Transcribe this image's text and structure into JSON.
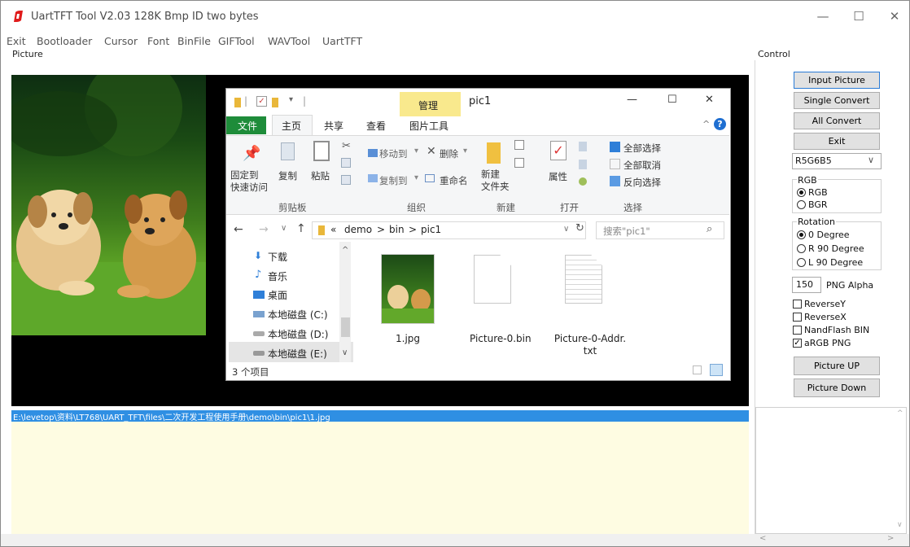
{
  "window": {
    "title": "UartTFT Tool V2.03 128K Bmp ID two bytes",
    "minimize_glyph": "—",
    "maximize_glyph": "☐",
    "close_glyph": "✕"
  },
  "menu": [
    "Exit",
    "Bootloader",
    "Cursor",
    "Font",
    "BinFile",
    "GIFTool",
    "WAVTool",
    "UartTFT"
  ],
  "sections": {
    "picture": "Picture",
    "control": "Control"
  },
  "explorer": {
    "context_tab": "管理",
    "folder_title": "pic1",
    "tabs": [
      "文件",
      "主页",
      "共享",
      "查看",
      "图片工具"
    ],
    "min_glyph": "—",
    "max_glyph": "☐",
    "close_glyph": "✕",
    "ribbon": {
      "pin": "固定到\n快速访问",
      "copy": "复制",
      "paste": "粘贴",
      "move_to": "移动到",
      "delete": "删除",
      "copy_to": "复制到",
      "rename": "重命名",
      "new_folder": "新建\n文件夹",
      "properties": "属性",
      "select_all": "全部选择",
      "select_none": "全部取消",
      "invert": "反向选择",
      "groups": [
        "剪贴板",
        "组织",
        "新建",
        "打开",
        "选择"
      ]
    },
    "address": [
      "«",
      "demo",
      ">",
      "bin",
      ">",
      "pic1"
    ],
    "search_placeholder": "搜索\"pic1\"",
    "nav_items": [
      "下载",
      "音乐",
      "桌面",
      "本地磁盘 (C:)",
      "本地磁盘 (D:)",
      "本地磁盘 (E:)"
    ],
    "files": [
      {
        "name": "1.jpg",
        "icon": "jpg-thumbnail-icon"
      },
      {
        "name": "Picture-0.bin",
        "icon": "blank-file-icon"
      },
      {
        "name": "Picture-0-Addr.\ntxt",
        "icon": "text-file-icon"
      }
    ],
    "status": "3 个项目"
  },
  "controls": {
    "input_picture": "Input Picture",
    "single_convert": "Single Convert",
    "all_convert": "All Convert",
    "exit": "Exit",
    "format": "R5G6B5",
    "rgb_group": "RGB",
    "rgb_options": [
      "RGB",
      "BGR"
    ],
    "rotation_group": "Rotation",
    "rotation_options": [
      "0 Degree",
      "R 90 Degree",
      "L 90 Degree"
    ],
    "alpha_value": "150",
    "alpha_label": "PNG  Alpha",
    "checkboxes": [
      {
        "label": "ReverseY",
        "checked": false
      },
      {
        "label": "ReverseX",
        "checked": false
      },
      {
        "label": "NandFlash BIN",
        "checked": false
      },
      {
        "label": "aRGB PNG",
        "checked": true
      }
    ],
    "picture_up": "Picture UP",
    "picture_down": "Picture Down"
  },
  "log": {
    "path": "E:\\levetop\\资料\\LT768\\UART_TFT\\files\\二次开发工程使用手册\\demo\\bin\\pic1\\1.jpg"
  },
  "colors": {
    "accent": "#2f8fe3",
    "log_background": "#fefce2",
    "brand_red": "#e01b1b"
  }
}
